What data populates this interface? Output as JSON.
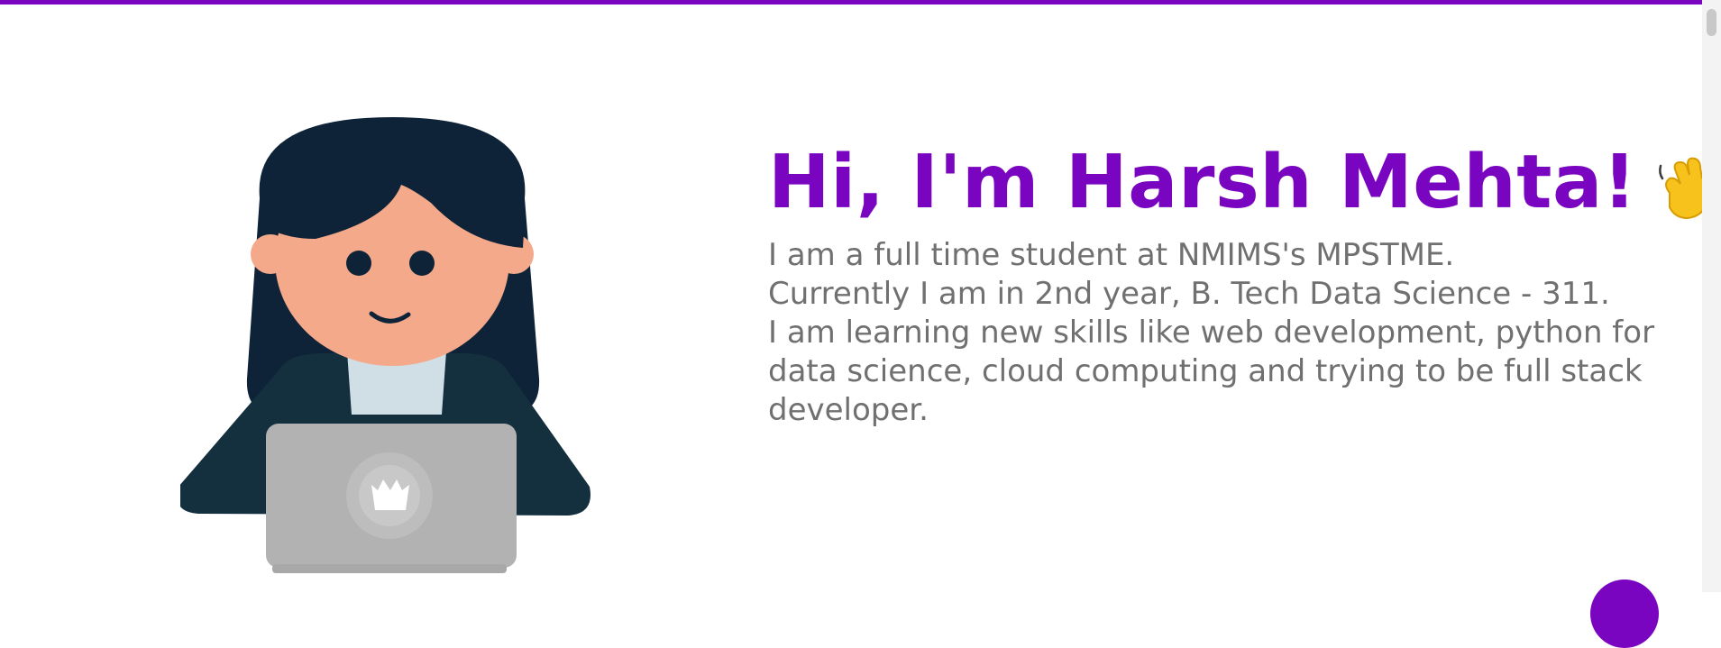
{
  "theme": {
    "accent": "#7a05c0",
    "body_text": "#707070",
    "background": "#ffffff"
  },
  "hero": {
    "greeting": "Hi, I'm Harsh Mehta!",
    "greeting_icon": "waving-hand-icon",
    "illustration": "girl-with-laptop-illustration",
    "bio_lines": [
      "I am a full time student at NMIMS's MPSTME.",
      "Currently I am in 2nd year, B. Tech Data Science - 311.",
      "I am learning new skills like web development, python for data science, cloud computing and trying to be full stack developer."
    ]
  },
  "floating_button": {
    "icon": "scroll-to-top-icon"
  }
}
